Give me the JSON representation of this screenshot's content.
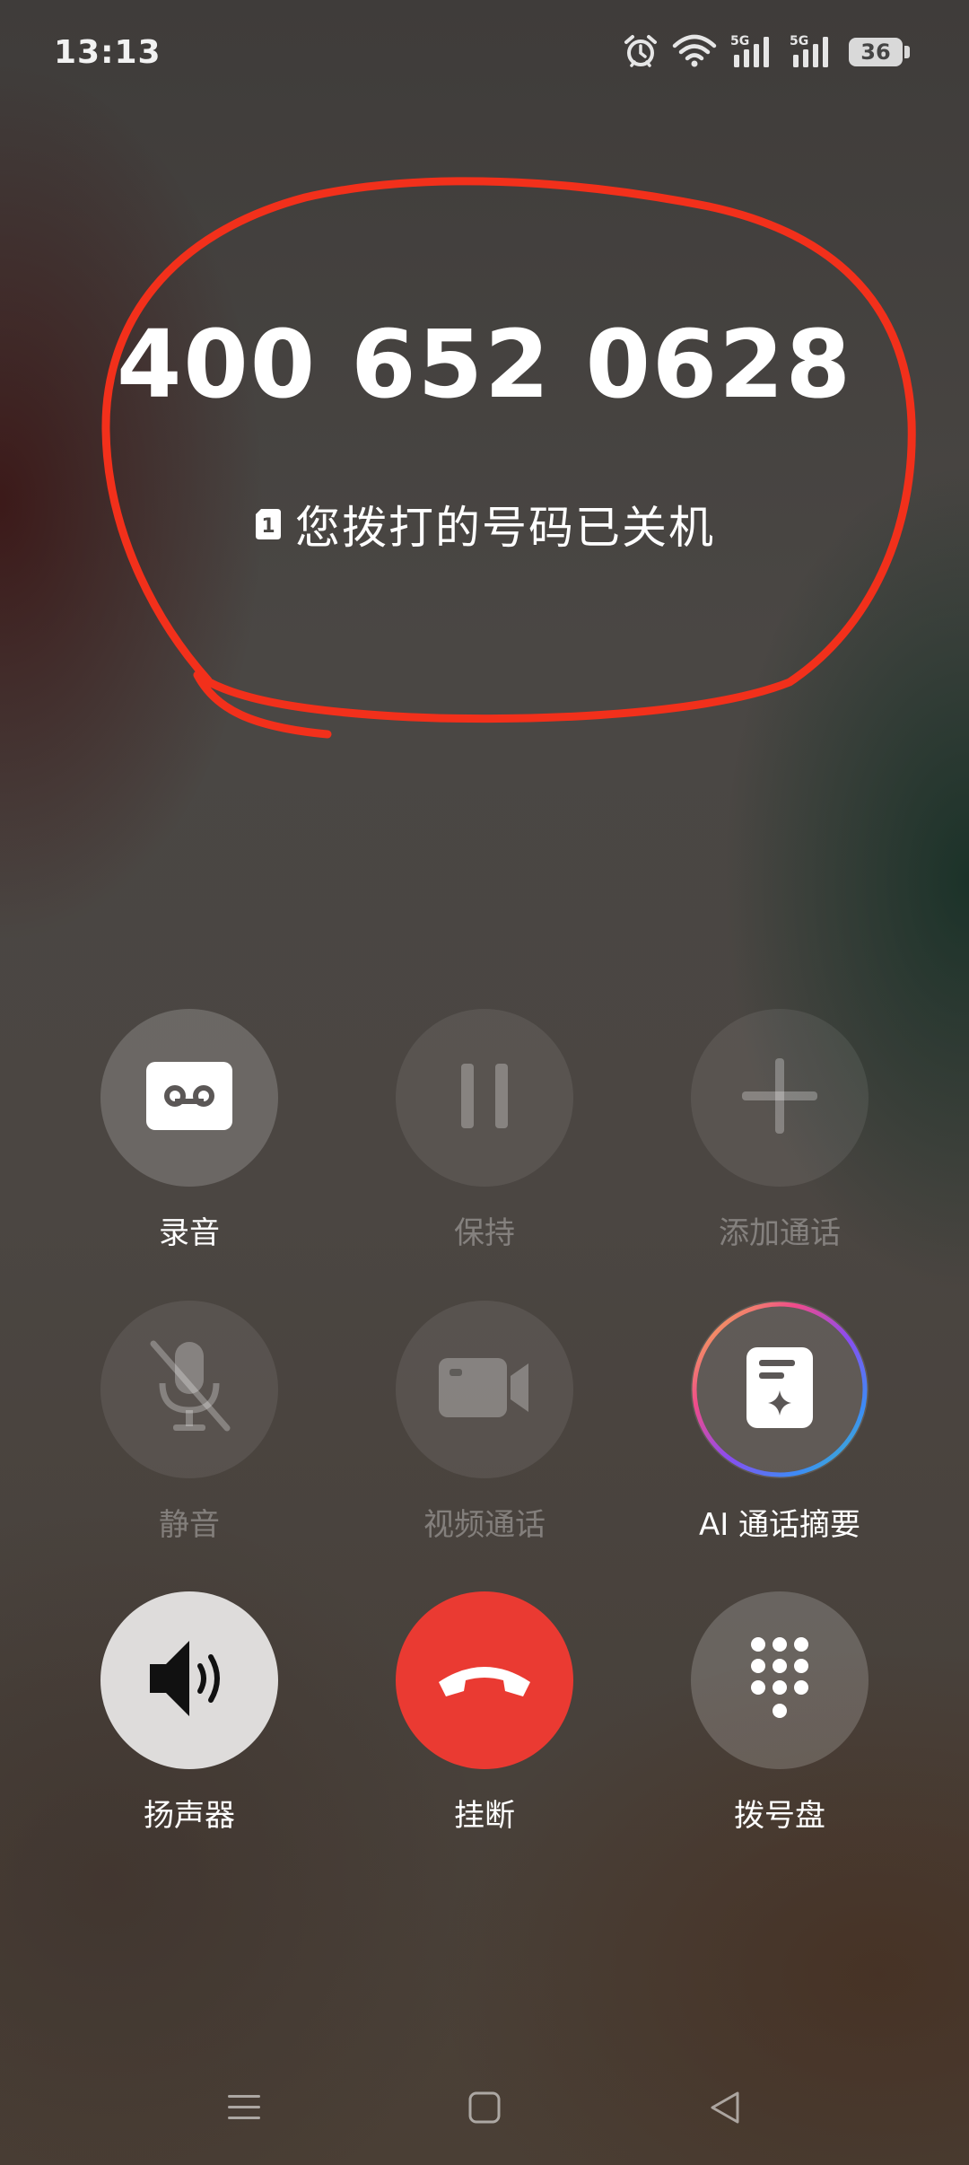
{
  "status_bar": {
    "time": "13:13",
    "battery_level": "36",
    "network_labels": [
      "5G",
      "5G"
    ],
    "icons": [
      "alarm-icon",
      "wifi-icon",
      "signal-5g-icon",
      "signal-5g-icon",
      "battery-icon"
    ]
  },
  "call": {
    "number": "400 652 0628",
    "sim_slot": "1",
    "status_text": "您拨打的号码已关机"
  },
  "annotation": {
    "color": "#f2301b"
  },
  "controls": {
    "record": {
      "label": "录音",
      "icon": "cassette-icon",
      "enabled": true
    },
    "hold": {
      "label": "保持",
      "icon": "pause-icon",
      "enabled": false
    },
    "add_call": {
      "label": "添加通话",
      "icon": "plus-icon",
      "enabled": false
    },
    "mute": {
      "label": "静音",
      "icon": "mic-off-icon",
      "enabled": false
    },
    "video_call": {
      "label": "视频通话",
      "icon": "video-camera-icon",
      "enabled": false
    },
    "ai_summary": {
      "label": "AI 通话摘要",
      "icon": "ai-summary-icon",
      "enabled": true
    },
    "speaker": {
      "label": "扬声器",
      "icon": "speaker-icon",
      "enabled": true
    },
    "hangup": {
      "label": "挂断",
      "icon": "phone-hangup-icon",
      "enabled": true,
      "color": "#ea3a32"
    },
    "dialpad": {
      "label": "拨号盘",
      "icon": "dialpad-icon",
      "enabled": true
    }
  },
  "nav_bar": {
    "icons": [
      "menu-icon",
      "home-icon",
      "back-icon"
    ]
  }
}
